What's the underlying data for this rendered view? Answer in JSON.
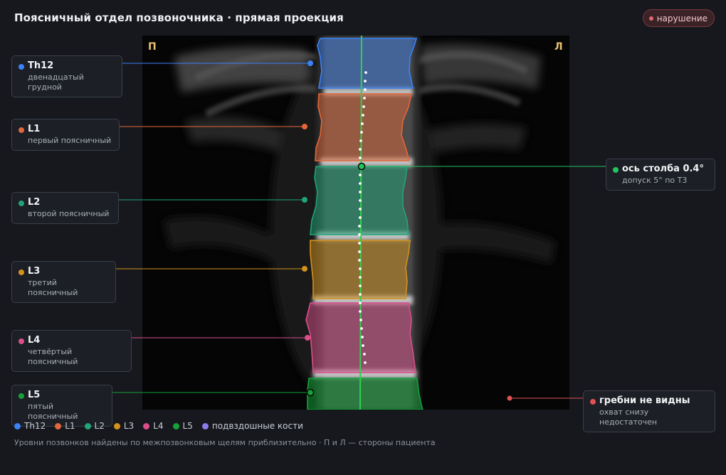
{
  "header": {
    "title": "Поясничный отдел позвоночника · прямая проекция",
    "status_badge": "нарушение"
  },
  "image": {
    "right_side_mark": "П",
    "left_side_mark": "Л"
  },
  "vertebrae": [
    {
      "code": "Th12",
      "name": "двенадцатый грудной",
      "color": "#3b82f6"
    },
    {
      "code": "L1",
      "name": "первый поясничный",
      "color": "#e2673a"
    },
    {
      "code": "L2",
      "name": "второй поясничный",
      "color": "#20a57a"
    },
    {
      "code": "L3",
      "name": "третий поясничный",
      "color": "#d4921c"
    },
    {
      "code": "L4",
      "name": "четвёртый поясничный",
      "color": "#d94f8a"
    },
    {
      "code": "L5",
      "name": "пятый поясничный",
      "color": "#15a13a"
    }
  ],
  "axis_card": {
    "title": "ось столба 0.4°",
    "subtitle": "допуск 5° по Т3",
    "color": "#22c55e"
  },
  "crest_card": {
    "title": "гребни не видны",
    "subtitle": "охват снизу недостаточен",
    "color": "#e05252"
  },
  "legend": [
    {
      "label": "Th12",
      "color": "#3b82f6"
    },
    {
      "label": "L1",
      "color": "#e2673a"
    },
    {
      "label": "L2",
      "color": "#20a57a"
    },
    {
      "label": "L3",
      "color": "#d4921c"
    },
    {
      "label": "L4",
      "color": "#d94f8a"
    },
    {
      "label": "L5",
      "color": "#15a13a"
    },
    {
      "label": "подвздошные кости",
      "color": "#8b7cf0"
    }
  ],
  "footnote": "Уровни позвонков найдены по межпозвонковым щелям приблизительно · П и Л — стороны пациента"
}
